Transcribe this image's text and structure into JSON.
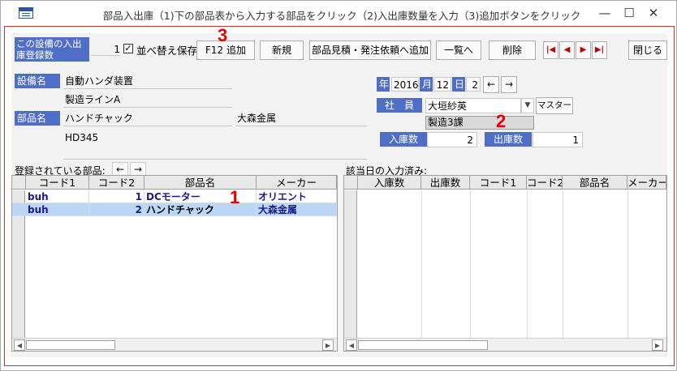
{
  "window": {
    "title": "部品入出庫（1)下の部品表から入力する部品をクリック（2)入出庫数量を入力（3)追加ボタンをクリック",
    "minimize": "—",
    "maximize": "☐",
    "close": "✕"
  },
  "toolbar": {
    "count_label": "この設備の入出庫登録数",
    "count_value": "1",
    "sort_save_label": "並べ替え保存",
    "sort_save_checked": true,
    "add_button": "F12 追加",
    "new_button": "新規",
    "quote_button": "部品見積・発注依頼へ追加",
    "list_button": "一覧へ",
    "delete_button": "削除",
    "close_button": "閉じる"
  },
  "equipment": {
    "label": "設備名",
    "name": "自動ハンダ装置",
    "line": "製造ラインA"
  },
  "part": {
    "label": "部品名",
    "name": "ハンドチャック",
    "maker": "大森金属",
    "model": "HD345"
  },
  "date": {
    "year_label": "年",
    "year": "2016",
    "month_label": "月",
    "month": "12",
    "day_label": "日",
    "day": "2",
    "prev": "←",
    "next": "→"
  },
  "employee": {
    "label": "社　員",
    "name": "大垣紗英",
    "master_button": "マスター",
    "department": "製造3課"
  },
  "quantities": {
    "in_label": "入庫数",
    "in_value": "2",
    "out_label": "出庫数",
    "out_value": "1"
  },
  "annotations": {
    "step1": "1",
    "step2": "2",
    "step3": "3"
  },
  "registered_parts": {
    "caption": "登録されている部品:",
    "prev": "←",
    "next": "→",
    "columns": [
      "コード1",
      "コード2",
      "部品名",
      "メーカー"
    ],
    "rows": [
      {
        "code1": "buh",
        "code2": "1",
        "name": "DCモーター",
        "maker": "オリエント"
      },
      {
        "code1": "buh",
        "code2": "2",
        "name": "ハンドチャック",
        "maker": "大森金属"
      }
    ]
  },
  "entered_today": {
    "caption": "該当日の入力済み:",
    "columns": [
      "入庫数",
      "出庫数",
      "コード1",
      "コード2",
      "部品名",
      "メーカー"
    ]
  },
  "colors": {
    "label_blue": "#4f6fc6",
    "selected_row": "#bcd7f5",
    "annotation_red": "#e60000",
    "grid_text": "#1a1a8c"
  }
}
